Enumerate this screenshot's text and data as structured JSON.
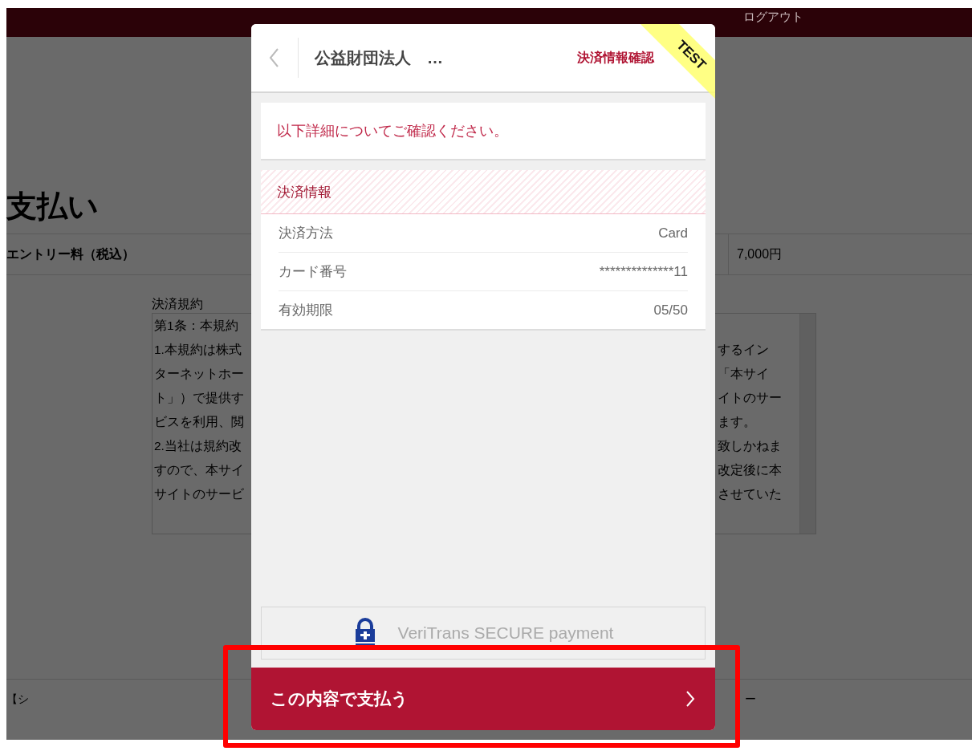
{
  "header": {
    "logout": "ログアウト"
  },
  "page": {
    "title": "支払い",
    "fee": {
      "label": "エントリー料（税込）",
      "amount": "7,000円"
    },
    "terms": {
      "label": "決済規約",
      "lines": [
        {
          "left": "第1条：本規約"
        },
        {
          "left": "1.本規約は株式",
          "right": "するイン"
        },
        {
          "left": "ターネットホー",
          "right": "「本サイ"
        },
        {
          "left": "ト」）で提供す",
          "right": "イトのサー"
        },
        {
          "left": "ビスを利用、閲",
          "right": "ます。"
        },
        {
          "left": "2.当社は規約改",
          "right": "致しかねま"
        },
        {
          "left": "すので、本サイ",
          "right": "改定後に本"
        },
        {
          "left": "サイトのサービ",
          "right": "させていた"
        }
      ]
    },
    "footer": {
      "left": "【シ",
      "right": "ー"
    }
  },
  "modal": {
    "merchant": "公益財団法人",
    "more": "…",
    "step": "決済情報確認",
    "ribbon": "TEST",
    "message": "以下詳細についてご確認ください。",
    "section": "決済情報",
    "rows": [
      {
        "label": "決済方法",
        "value": "Card"
      },
      {
        "label": "カード番号",
        "value": "**************11"
      },
      {
        "label": "有効期限",
        "value": "05/50"
      }
    ],
    "provider": "VeriTrans SECURE payment",
    "submit": "この内容で支払う"
  }
}
